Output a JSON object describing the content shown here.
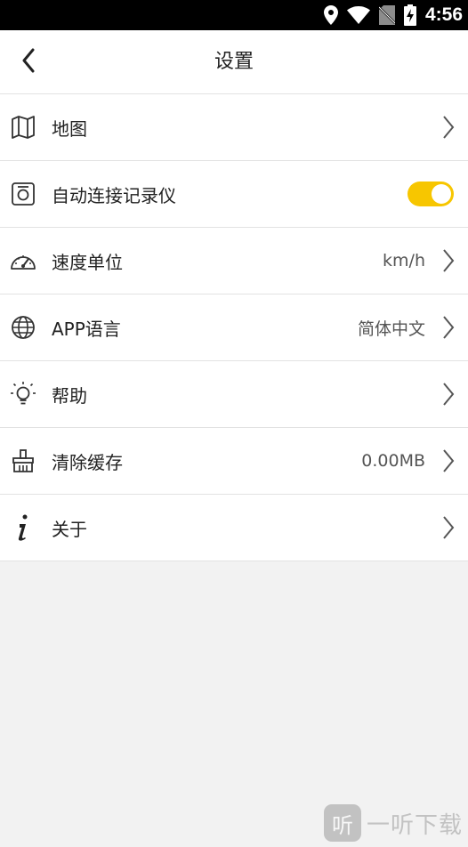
{
  "status_bar": {
    "time": "4:56",
    "icons": [
      "location-icon",
      "wifi-icon",
      "no-sim-icon",
      "battery-charging-icon"
    ]
  },
  "header": {
    "title": "设置",
    "back_icon": "chevron-left-icon"
  },
  "settings": [
    {
      "icon": "map-icon",
      "label": "地图",
      "value": "",
      "control": "chevron"
    },
    {
      "icon": "camera-recorder-icon",
      "label": "自动连接记录仪",
      "value": "",
      "control": "toggle",
      "toggle_on": true
    },
    {
      "icon": "speedometer-icon",
      "label": "速度单位",
      "value": "km/h",
      "control": "chevron"
    },
    {
      "icon": "globe-icon",
      "label": "APP语言",
      "value": "简体中文",
      "control": "chevron"
    },
    {
      "icon": "lightbulb-icon",
      "label": "帮助",
      "value": "",
      "control": "chevron"
    },
    {
      "icon": "broom-icon",
      "label": "清除缓存",
      "value": "0.00MB",
      "control": "chevron"
    },
    {
      "icon": "info-icon",
      "label": "关于",
      "value": "",
      "control": "chevron"
    }
  ],
  "watermark": {
    "logo_text": "听",
    "text": "一听下载"
  },
  "colors": {
    "accent": "#f7c600",
    "background": "#f2f2f2",
    "divider": "#e2e2e2",
    "status_bar": "#000000"
  }
}
